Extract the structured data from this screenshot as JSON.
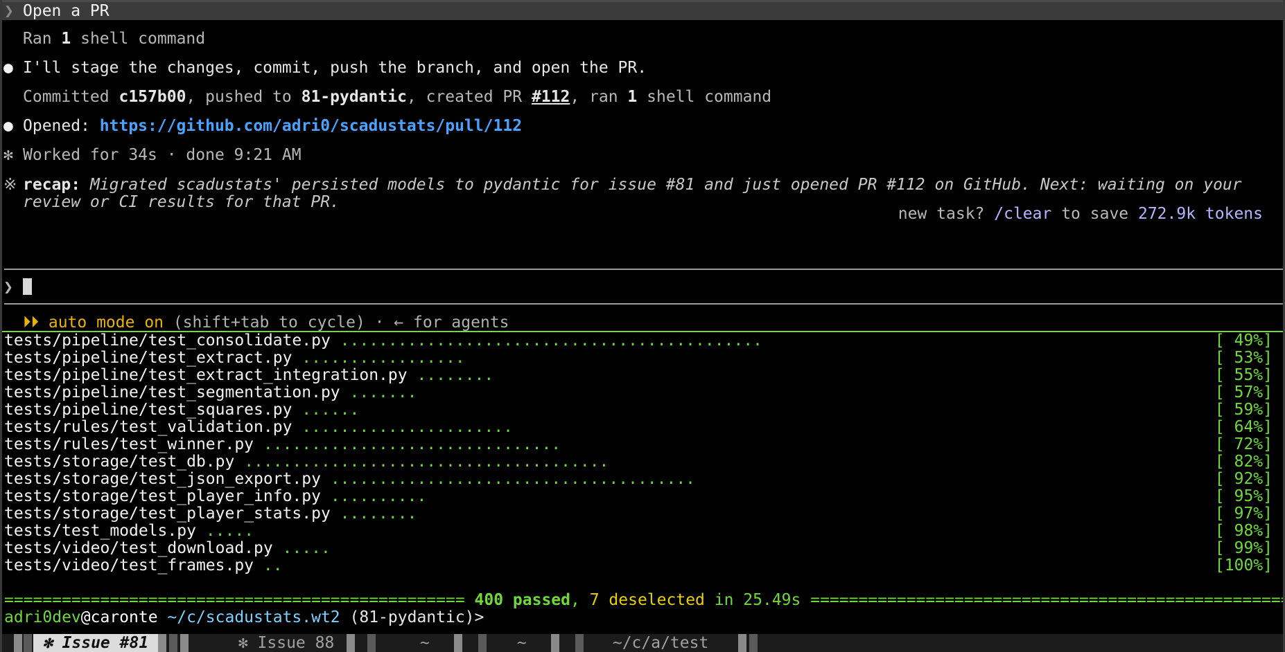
{
  "session": {
    "user_prompt": "Open a PR",
    "prompt_chevron": "❯",
    "ran_shell": {
      "prefix": "Ran ",
      "count": "1",
      "suffix": " shell command"
    },
    "message1": "I'll stage the changes, commit, push the branch, and open the PR.",
    "bullet": "●",
    "commit_line": {
      "committed": "Committed ",
      "hash": "c157b00",
      "pushed": ", pushed to ",
      "branch": "81-pydantic",
      "created": ", created PR ",
      "pr": "#112",
      "ran": ", ran ",
      "count": "1",
      "suffix": " shell command"
    },
    "opened_label": "Opened: ",
    "opened_url": "https://github.com/adri0/scadustats/pull/112",
    "worked_star": "✻",
    "worked": "Worked for 34s · done 9:21 AM",
    "recap_star": "※",
    "recap_label": "recap:",
    "recap_text_1": "Migrated scadustats' persisted models to pydantic for issue #81 and just opened PR #112 on GitHub. Next: waiting on your",
    "recap_text_2": "review or CI results for that PR.",
    "new_task": {
      "prefix": "new task? ",
      "command": "/clear",
      "middle": " to save ",
      "tokens": "272.9k tokens"
    },
    "input_chevron": "❯",
    "auto_mode": {
      "label": "⏵⏵ auto mode on",
      "hint": " (shift+tab to cycle) · ← for agents"
    }
  },
  "tests": [
    {
      "file": "tests/pipeline/test_consolidate.py",
      "dots": "............................................",
      "pct": "[ 49%]"
    },
    {
      "file": "tests/pipeline/test_extract.py",
      "dots": ".................",
      "pct": "[ 53%]"
    },
    {
      "file": "tests/pipeline/test_extract_integration.py",
      "dots": "........",
      "pct": "[ 55%]"
    },
    {
      "file": "tests/pipeline/test_segmentation.py",
      "dots": ".......",
      "pct": "[ 57%]"
    },
    {
      "file": "tests/pipeline/test_squares.py",
      "dots": "......",
      "pct": "[ 59%]"
    },
    {
      "file": "tests/rules/test_validation.py",
      "dots": "......................",
      "pct": "[ 64%]"
    },
    {
      "file": "tests/rules/test_winner.py",
      "dots": "...............................",
      "pct": "[ 72%]"
    },
    {
      "file": "tests/storage/test_db.py",
      "dots": "......................................",
      "pct": "[ 82%]"
    },
    {
      "file": "tests/storage/test_json_export.py",
      "dots": "......................................",
      "pct": "[ 92%]"
    },
    {
      "file": "tests/storage/test_player_info.py",
      "dots": "..........",
      "pct": "[ 95%]"
    },
    {
      "file": "tests/storage/test_player_stats.py",
      "dots": "........",
      "pct": "[ 97%]"
    },
    {
      "file": "tests/test_models.py",
      "dots": ".....",
      "pct": "[ 98%]"
    },
    {
      "file": "tests/video/test_download.py",
      "dots": ".....",
      "pct": "[ 99%]"
    },
    {
      "file": "tests/video/test_frames.py",
      "dots": "..",
      "pct": "[100%]"
    }
  ],
  "summary": {
    "bar_left": "================================================",
    "passed": "400 passed",
    "comma": ", ",
    "deselected": "7 deselected",
    "in": " in 25.49s ",
    "bar_right": "============================================================"
  },
  "shell_prompt": {
    "user": "adri0dev",
    "host": "@caronte",
    "path": " ~/c/scadustats.wt2",
    "branch": " (81-pydantic)>"
  },
  "tabs": {
    "active": " ✻ Issue #81 ",
    "tab2": " ✻ Issue 88 ",
    "tab3": " ~ ",
    "tab4": " ~ ",
    "tab5": " ~/c/a/test "
  }
}
